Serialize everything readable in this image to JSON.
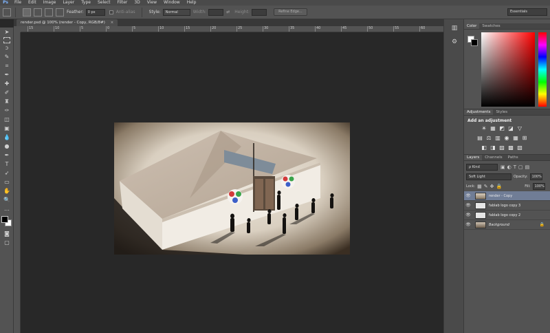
{
  "app": {
    "logo": "Ps"
  },
  "menu": [
    "File",
    "Edit",
    "Image",
    "Layer",
    "Type",
    "Select",
    "Filter",
    "3D",
    "View",
    "Window",
    "Help"
  ],
  "options": {
    "feather_label": "Feather:",
    "feather_value": "0 px",
    "antialias_label": "Anti-alias",
    "style_label": "Style:",
    "style_value": "Normal",
    "width_label": "Width:",
    "height_label": "Height:",
    "refine_edge": "Refine Edge...",
    "workspace": "Essentials"
  },
  "document": {
    "tab_title": "render.psd @ 100% (render - Copy, RGB/8#)",
    "close": "×",
    "ruler_ticks": [
      "15",
      "10",
      "5",
      "0",
      "5",
      "10",
      "15",
      "20",
      "25",
      "30",
      "35",
      "40",
      "45",
      "50",
      "55",
      "60"
    ]
  },
  "panels": {
    "color": {
      "tabs": [
        "Color",
        "Swatches"
      ]
    },
    "adjustments": {
      "tabs": [
        "Adjustments",
        "Styles"
      ],
      "title": "Add an adjustment",
      "row1": [
        "☀",
        "▦",
        "◩",
        "◪",
        "▽"
      ],
      "row2": [
        "▤",
        "⚖",
        "▥",
        "◉",
        "▦",
        "⊞"
      ],
      "row3": [
        "◧",
        "◨",
        "▨",
        "▩",
        "▧"
      ]
    },
    "layers": {
      "tabs": [
        "Layers",
        "Channels",
        "Paths"
      ],
      "filter_kind": "ρ Kind",
      "blend_mode": "Soft Light",
      "opacity_label": "Opacity:",
      "opacity_value": "100%",
      "lock_label": "Lock:",
      "fill_label": "Fill:",
      "fill_value": "100%",
      "items": [
        {
          "name": "render - Copy",
          "selected": true
        },
        {
          "name": "fablab logo copy 3"
        },
        {
          "name": "fablab logo copy 2"
        },
        {
          "name": "Background",
          "locked": true
        }
      ]
    }
  },
  "colors": {
    "accent_selected_layer": "#707d96",
    "logo_red": "#d23a3a",
    "logo_green": "#3aa34a",
    "logo_blue": "#3c5fc8"
  }
}
